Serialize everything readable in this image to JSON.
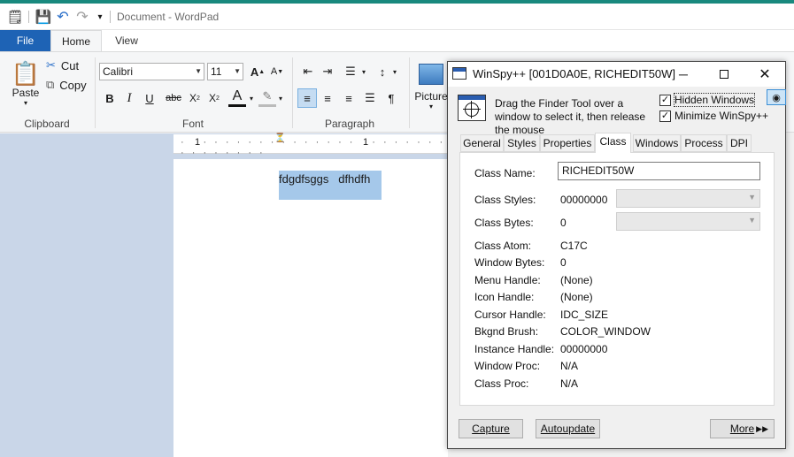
{
  "wordpad": {
    "title": "Document - WordPad",
    "tabs": {
      "file": "File",
      "home": "Home",
      "view": "View"
    },
    "clipboard": {
      "paste": "Paste",
      "cut": "Cut",
      "copy": "Copy",
      "group": "Clipboard"
    },
    "font": {
      "family": "Calibri",
      "size": "11",
      "group": "Font"
    },
    "paragraph": {
      "group": "Paragraph"
    },
    "insert": {
      "picture": "Picture"
    },
    "ruler": {
      "mark1": "1",
      "mark2": "1"
    },
    "document_text": "fdgdfsggs   dfhdfh"
  },
  "winspy": {
    "title": "WinSpy++ [001D0A0E, RICHEDIT50W]",
    "finder_text": "Drag the Finder Tool over a window to select it, then release the mouse",
    "hidden_windows": "Hidden Windows",
    "minimize": "Minimize WinSpy++",
    "tabs": [
      "General",
      "Styles",
      "Properties",
      "Class",
      "Windows",
      "Process",
      "DPI"
    ],
    "active_tab": "Class",
    "class_name_label": "Class Name:",
    "class_name_value": "RICHEDIT50W",
    "class_styles_label": "Class Styles:",
    "class_styles_value": "00000000",
    "class_bytes_label": "Class Bytes:",
    "class_bytes_value": "0",
    "properties": [
      {
        "label": "Class Atom:",
        "value": "C17C"
      },
      {
        "label": "Window Bytes:",
        "value": "0"
      },
      {
        "label": "Menu Handle:",
        "value": "(None)"
      },
      {
        "label": "Icon Handle:",
        "value": "(None)"
      },
      {
        "label": "Cursor Handle:",
        "value": "IDC_SIZE"
      },
      {
        "label": "Bkgnd Brush:",
        "value": "COLOR_WINDOW"
      },
      {
        "label": "Instance Handle:",
        "value": "00000000"
      },
      {
        "label": "Window Proc:",
        "value": "N/A"
      },
      {
        "label": "Class Proc:",
        "value": "N/A"
      }
    ],
    "buttons": {
      "capture": "Capture",
      "autoupdate": "Autoupdate",
      "more": "More"
    }
  }
}
